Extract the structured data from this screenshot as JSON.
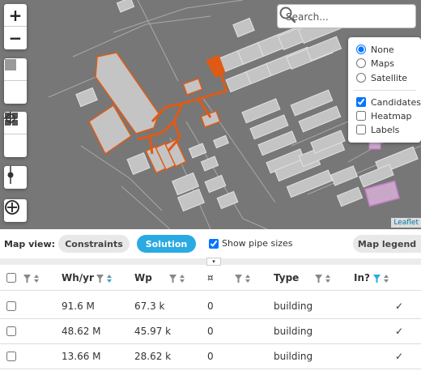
{
  "map": {
    "zoom_in_label": "+",
    "zoom_out_label": "−",
    "search": {
      "placeholder": "Search..."
    },
    "layers": {
      "basemap_options": [
        "None",
        "Maps",
        "Satellite"
      ],
      "basemap_selected": "None",
      "overlays": [
        {
          "label": "Candidates",
          "checked": true
        },
        {
          "label": "Heatmap",
          "checked": false
        },
        {
          "label": "Labels",
          "checked": false
        }
      ]
    },
    "attribution": "Leaflet"
  },
  "map_view": {
    "label": "Map view:",
    "constraints_label": "Constraints",
    "solution_label": "Solution",
    "pipe_sizes_label": "Show pipe sizes",
    "pipe_sizes_checked": true,
    "legend_label": "Map legend",
    "colors": {
      "active": "#2aaae2",
      "pipe": "#e05a14"
    }
  },
  "table": {
    "collapse_label": "▾",
    "headers": [
      "Wh/yr",
      "Wp",
      "¤",
      "Type",
      "In?"
    ],
    "rows": [
      {
        "whyr": "91.6 M",
        "wp": "67.3 k",
        "cost": "0",
        "type": "building",
        "in": "✓"
      },
      {
        "whyr": "48.62 M",
        "wp": "45.97 k",
        "cost": "0",
        "type": "building",
        "in": "✓"
      },
      {
        "whyr": "13.66 M",
        "wp": "28.62 k",
        "cost": "0",
        "type": "building",
        "in": "✓"
      }
    ]
  }
}
